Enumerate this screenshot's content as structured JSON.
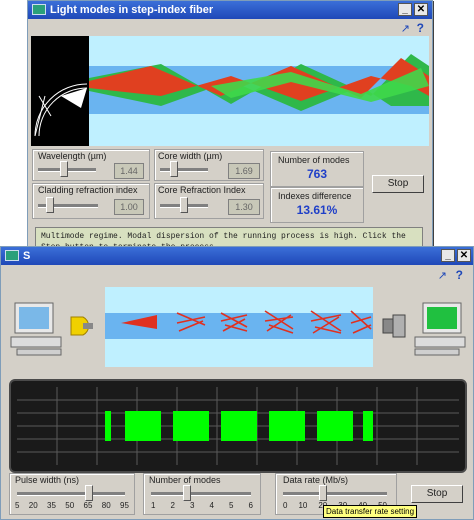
{
  "top_window": {
    "title": "Light modes in step-index fiber",
    "controls": {
      "wavelength": {
        "label": "Wavelength (µm)",
        "value": "1.44"
      },
      "core_width": {
        "label": "Core width (µm)",
        "value": "1.69"
      },
      "cladding_index": {
        "label": "Cladding refraction index",
        "value": "1.00"
      },
      "core_index": {
        "label": "Core Refraction Index",
        "value": "1.30"
      }
    },
    "stats": {
      "modes_label": "Number of modes",
      "modes_value": "763",
      "indexes_label": "Indexes difference",
      "indexes_value": "13.61%"
    },
    "stop_label": "Stop",
    "message": "Multimode regime. Modal dispersion of the running process is high. Click the Stop button to terminate the process."
  },
  "bottom_window": {
    "title": "S",
    "controls": {
      "pulse_width": {
        "label": "Pulse width (ns)",
        "ticks": [
          "5",
          "20",
          "35",
          "50",
          "65",
          "80",
          "95"
        ]
      },
      "num_modes": {
        "label": "Number of modes",
        "ticks": [
          "1",
          "2",
          "3",
          "4",
          "5",
          "6"
        ]
      },
      "data_rate": {
        "label": "Data rate (Mb/s)",
        "ticks": [
          "0",
          "10",
          "20",
          "30",
          "40",
          "50"
        ]
      }
    },
    "tooltip": "Data transfer rate setting",
    "stop_label": "Stop",
    "pulse_count": 7
  },
  "colors": {
    "window_bg": "#d4d0c8",
    "title_blue": "#2456c8",
    "fiber_cyan": "#bff0ff",
    "core_blue": "#6ab4f0",
    "pulse_green": "#00ff00",
    "scope_bg": "#2a2a2a"
  },
  "icons": [
    "help-icon",
    "pointer-icon",
    "close-icon",
    "computer-icon",
    "lamp-icon",
    "receiver-icon"
  ]
}
